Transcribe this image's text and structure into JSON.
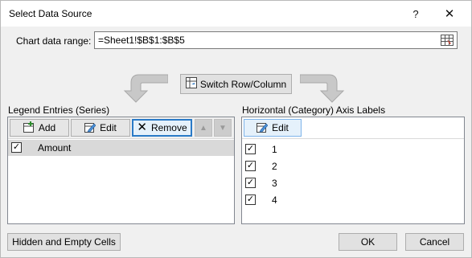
{
  "window": {
    "title": "Select Data Source",
    "help": "?",
    "close": "✕"
  },
  "range": {
    "label": "Chart data range:",
    "value": "=Sheet1!$B$1:$B$5"
  },
  "switch_button": "Switch Row/Column",
  "legend": {
    "label": "Legend Entries (Series)",
    "add": "Add",
    "edit": "Edit",
    "remove": "Remove",
    "items": [
      {
        "label": "Amount",
        "checked": true
      }
    ]
  },
  "axis": {
    "label": "Horizontal (Category) Axis Labels",
    "edit": "Edit",
    "items": [
      {
        "label": "1",
        "checked": true
      },
      {
        "label": "2",
        "checked": true
      },
      {
        "label": "3",
        "checked": true
      },
      {
        "label": "4",
        "checked": true
      }
    ]
  },
  "footer": {
    "hidden_cells": "Hidden and Empty Cells",
    "ok": "OK",
    "cancel": "Cancel"
  }
}
